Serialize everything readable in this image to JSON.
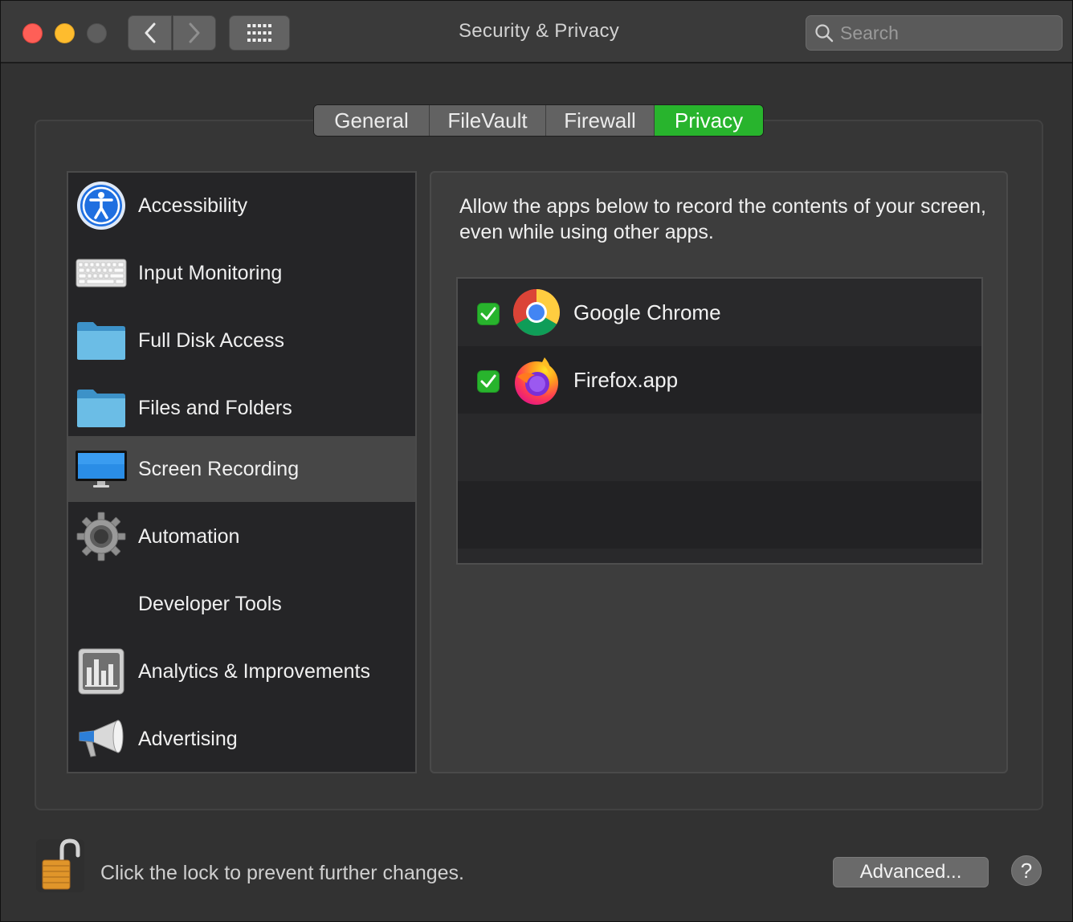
{
  "window": {
    "title": "Security & Privacy"
  },
  "toolbar": {
    "back_icon": "chevron-left-icon",
    "forward_icon": "chevron-right-icon",
    "grid_icon": "grid-icon"
  },
  "search": {
    "placeholder": "Search",
    "value": ""
  },
  "tabs": [
    {
      "label": "General",
      "active": false
    },
    {
      "label": "FileVault",
      "active": false
    },
    {
      "label": "Firewall",
      "active": false
    },
    {
      "label": "Privacy",
      "active": true
    }
  ],
  "sidebar": {
    "items": [
      {
        "label": "Accessibility",
        "icon": "accessibility-icon"
      },
      {
        "label": "Input Monitoring",
        "icon": "keyboard-icon"
      },
      {
        "label": "Full Disk Access",
        "icon": "folder-icon"
      },
      {
        "label": "Files and Folders",
        "icon": "folder-icon"
      },
      {
        "label": "Screen Recording",
        "icon": "display-icon",
        "selected": true
      },
      {
        "label": "Automation",
        "icon": "gear-icon"
      },
      {
        "label": "Developer Tools",
        "icon": ""
      },
      {
        "label": "Analytics & Improvements",
        "icon": "bar-chart-icon"
      },
      {
        "label": "Advertising",
        "icon": "megaphone-icon"
      }
    ]
  },
  "panel": {
    "description": "Allow the apps below to record the contents of your screen, even while using other apps.",
    "apps": [
      {
        "name": "Google Chrome",
        "checked": true,
        "icon": "chrome-icon"
      },
      {
        "name": "Firefox.app",
        "checked": true,
        "icon": "firefox-icon"
      }
    ]
  },
  "footer": {
    "lock_text": "Click the lock to prevent further changes.",
    "advanced_label": "Advanced...",
    "help_label": "?"
  },
  "colors": {
    "accent": "#28b42d",
    "close": "#fe5f57",
    "minimize": "#febc2e"
  }
}
